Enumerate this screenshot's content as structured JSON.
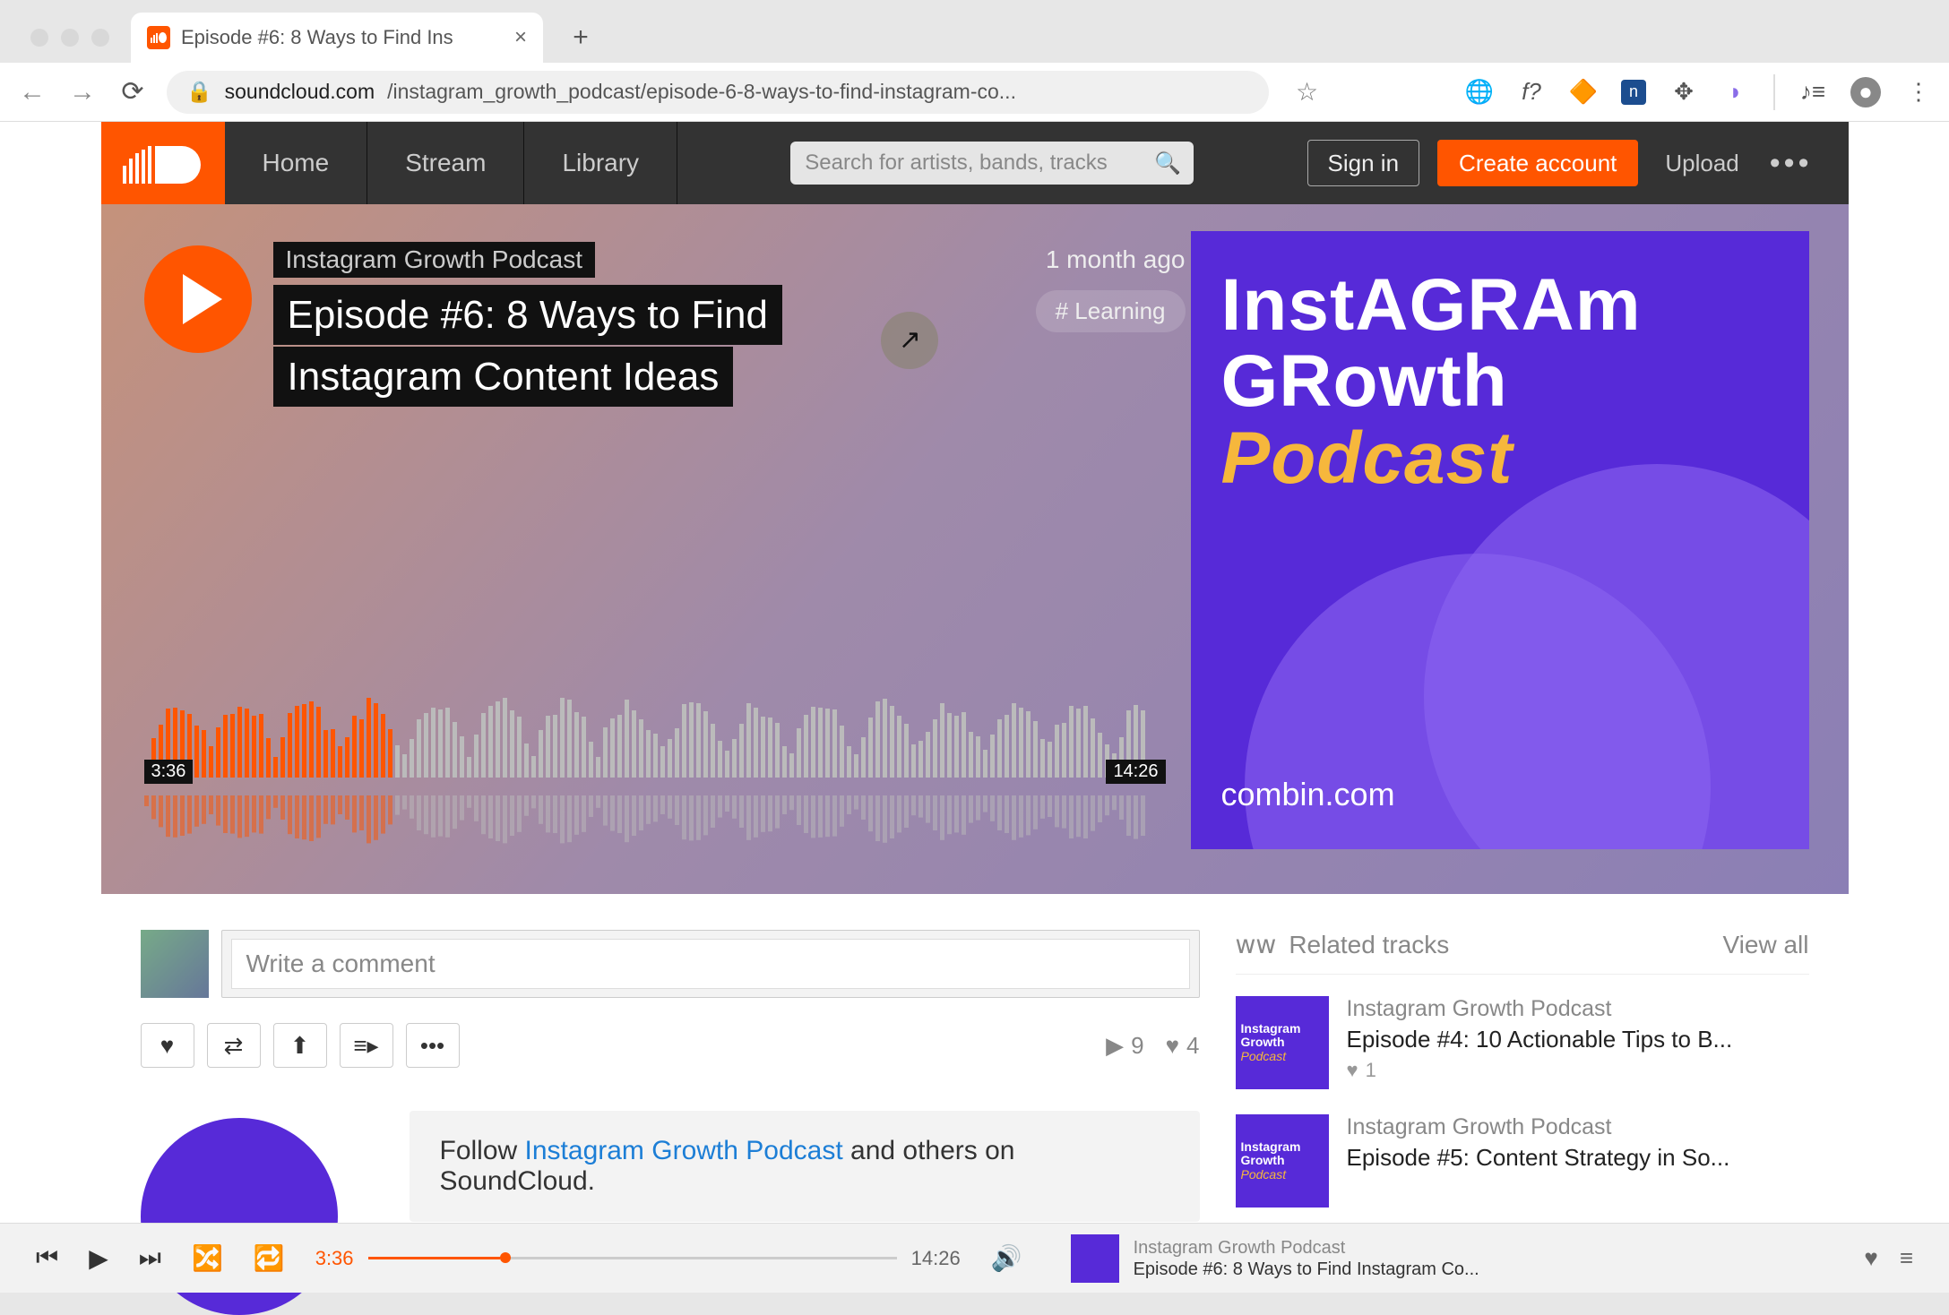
{
  "browser": {
    "tab_title": "Episode #6: 8 Ways to Find Ins",
    "url_host": "soundcloud.com",
    "url_path": "/instagram_growth_podcast/episode-6-8-ways-to-find-instagram-co..."
  },
  "nav": {
    "home": "Home",
    "stream": "Stream",
    "library": "Library",
    "search_placeholder": "Search for artists, bands, tracks",
    "sign_in": "Sign in",
    "create_account": "Create account",
    "upload": "Upload"
  },
  "hero": {
    "artist": "Instagram Growth Podcast",
    "title_line1": "Episode #6: 8 Ways to Find",
    "title_line2": "Instagram Content Ideas",
    "time_ago": "1 month ago",
    "tag": "# Learning",
    "cover_line1": "InstAGRAm",
    "cover_line2": "GRowth",
    "cover_line3": "Podcast",
    "cover_url": "combin.com",
    "elapsed": "3:36",
    "duration": "14:26"
  },
  "comment": {
    "placeholder": "Write a comment"
  },
  "stats": {
    "plays": "9",
    "likes": "4"
  },
  "follow": {
    "prefix": "Follow ",
    "link": "Instagram Growth Podcast",
    "suffix": " and others on SoundCloud."
  },
  "related": {
    "heading": "Related tracks",
    "view_all": "View all",
    "items": [
      {
        "artist": "Instagram Growth Podcast",
        "title": "Episode #4: 10 Actionable Tips to B...",
        "likes": "1"
      },
      {
        "artist": "Instagram Growth Podcast",
        "title": "Episode #5: Content Strategy in So..."
      }
    ]
  },
  "player": {
    "elapsed": "3:36",
    "duration": "14:26",
    "np_artist": "Instagram Growth Podcast",
    "np_title": "Episode #6: 8 Ways to Find Instagram Co..."
  }
}
